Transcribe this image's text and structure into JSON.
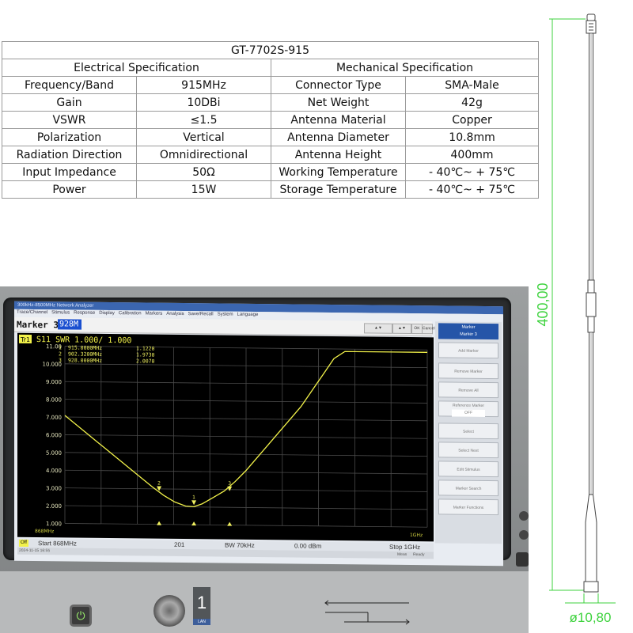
{
  "table": {
    "title": "GT-7702S-915",
    "left_header": "Electrical Specification",
    "right_header": "Mechanical Specification",
    "rows": [
      [
        "Frequency/Band",
        "915MHz",
        "Connector Type",
        "SMA-Male"
      ],
      [
        "Gain",
        "10DBi",
        "Net Weight",
        "42g"
      ],
      [
        "VSWR",
        "≤1.5",
        "Antenna Material",
        "Copper"
      ],
      [
        "Polarization",
        "Vertical",
        "Antenna Diameter",
        "10.8mm"
      ],
      [
        "Radiation Direction",
        "Omnidirectional",
        "Antenna Height",
        "400mm"
      ],
      [
        "Input Impedance",
        "50Ω",
        "Working Temperature",
        "- 40℃~ + 75℃"
      ],
      [
        "Power",
        "15W",
        "Storage Temperature",
        "- 40℃~ + 75℃"
      ]
    ]
  },
  "drawing": {
    "height_label": "400,00",
    "diameter_label": "ø10,80",
    "line_color": "#3cd23c"
  },
  "analyzer": {
    "window_title": "300kHz-8500MHz Network Analyzer",
    "menu": [
      "Trace/Channel",
      "Stimulus",
      "Response",
      "Display",
      "Calibration",
      "Markers",
      "Analysis",
      "Save/Recall",
      "System",
      "Language"
    ],
    "marker_prompt": "Marker 3",
    "marker_input": "928M",
    "ok_label": "OK",
    "cancel_label": "Cancel",
    "trace_label": "Tr1",
    "trace_title": "S11 SWR 1.000/ 1.000",
    "marker_readouts": [
      {
        "id": "1",
        "freq": "915.0000MHz",
        "value": "1.1220"
      },
      {
        "id": "2",
        "freq": "902.3200MHz",
        "value": "1.9730"
      },
      {
        "id": "3",
        "freq": "928.0000MHz",
        "value": "2.0070"
      }
    ],
    "softkeys": {
      "header_title": "Marker",
      "header_sub": "Marker 3",
      "items": [
        "Add Marker",
        "Remove Marker",
        "Remove All",
        "Reference Marker",
        "Select",
        "Select Next",
        "Edit Stimulus",
        "Marker Search",
        "Marker Functions"
      ],
      "ref_state": "OFF"
    },
    "status": {
      "badge": "Off",
      "start": "Start 868MHz",
      "points": "201",
      "bw": "BW 70kHz",
      "power": "0.00 dBm",
      "stop": "Stop 1GHz",
      "date": "2024-11-15 16:55",
      "meas": "Meas",
      "ready": "Ready"
    },
    "port_number": "1",
    "port_sub": "LAN",
    "accent_trace": "#f2f24a",
    "accent_marker": "#f0f060"
  },
  "chart_data": {
    "type": "line",
    "title": "S11 SWR 1.000/ 1.000",
    "x_unit": "MHz",
    "xlim": [
      868,
      1000
    ],
    "ylim": [
      0,
      11
    ],
    "yticks": [
      "11.00",
      "10.000",
      "9.000",
      "8.000",
      "7.000",
      "6.000",
      "5.000",
      "4.000",
      "3.000",
      "2.000",
      "1.000"
    ],
    "xtick_start_label": "868MHz",
    "xtick_end_label": "1GHz",
    "series": [
      {
        "x": [
          868,
          872,
          876,
          880,
          884,
          888,
          892,
          896,
          900,
          904,
          908,
          912,
          915,
          918,
          922,
          926,
          930,
          934,
          938,
          942,
          946,
          950,
          954,
          958,
          962,
          966,
          970,
          1000
        ],
        "y": [
          6.7,
          6.15,
          5.6,
          5.05,
          4.5,
          3.95,
          3.4,
          2.85,
          2.3,
          1.8,
          1.4,
          1.15,
          1.12,
          1.3,
          1.7,
          2.1,
          2.7,
          3.4,
          4.2,
          5.0,
          5.8,
          6.6,
          7.4,
          8.4,
          9.4,
          10.4,
          10.85,
          10.85
        ]
      }
    ],
    "markers": [
      {
        "id": "1",
        "x": 915,
        "y": 1.122
      },
      {
        "id": "2",
        "x": 902.32,
        "y": 1.973
      },
      {
        "id": "3",
        "x": 928,
        "y": 2.007
      }
    ]
  }
}
